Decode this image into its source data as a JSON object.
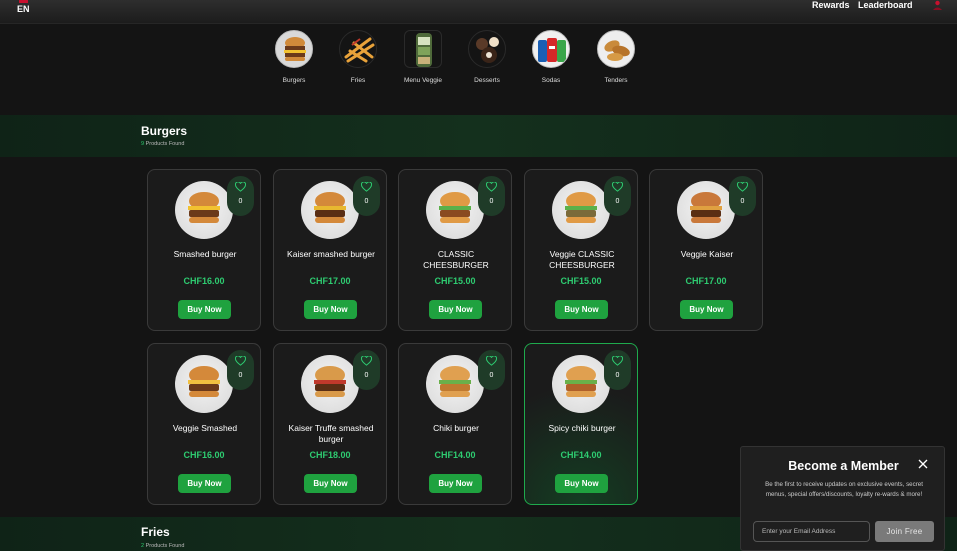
{
  "header": {
    "language": "EN",
    "nav": [
      "Rewards",
      "Leaderboard"
    ]
  },
  "categories": [
    {
      "label": "Burgers",
      "icon": "burger-icon"
    },
    {
      "label": "Fries",
      "icon": "fries-icon"
    },
    {
      "label": "Menu Veggie",
      "icon": "veggie-wrap-icon"
    },
    {
      "label": "Desserts",
      "icon": "dessert-icon"
    },
    {
      "label": "Sodas",
      "icon": "soda-cans-icon"
    },
    {
      "label": "Tenders",
      "icon": "tenders-icon"
    }
  ],
  "sections": [
    {
      "title": "Burgers",
      "count": "9",
      "count_suffix": " Products Found"
    },
    {
      "title": "Fries",
      "count": "2",
      "count_suffix": " Products Found"
    }
  ],
  "products": [
    {
      "name": "Smashed burger",
      "price": "CHF16.00",
      "likes": "0",
      "buy": "Buy Now",
      "image": "smashed-burger-image"
    },
    {
      "name": "Kaiser smashed burger",
      "price": "CHF17.00",
      "likes": "0",
      "buy": "Buy Now",
      "image": "kaiser-burger-image"
    },
    {
      "name": "CLASSIC CHEESBURGER",
      "price": "CHF15.00",
      "likes": "0",
      "buy": "Buy Now",
      "image": "classic-cheeseburger-image"
    },
    {
      "name": "Veggie CLASSIC CHEESBURGER",
      "price": "CHF15.00",
      "likes": "0",
      "buy": "Buy Now",
      "image": "veggie-cheeseburger-image"
    },
    {
      "name": "Veggie Kaiser",
      "price": "CHF17.00",
      "likes": "0",
      "buy": "Buy Now",
      "image": "veggie-kaiser-image"
    },
    {
      "name": "Veggie Smashed",
      "price": "CHF16.00",
      "likes": "0",
      "buy": "Buy Now",
      "image": "veggie-smashed-image"
    },
    {
      "name": "Kaiser Truffe smashed burger",
      "price": "CHF18.00",
      "likes": "0",
      "buy": "Buy Now",
      "image": "kaiser-truffe-image"
    },
    {
      "name": "Chiki burger",
      "price": "CHF14.00",
      "likes": "0",
      "buy": "Buy Now",
      "image": "chiki-burger-image"
    },
    {
      "name": "Spicy chiki burger",
      "price": "CHF14.00",
      "likes": "0",
      "buy": "Buy Now",
      "image": "spicy-chiki-burger-image"
    }
  ],
  "popup": {
    "title": "Become a Member",
    "description": "Be the first to receive updates on exclusive events, secret menus, special offers/discounts, loyalty re-wards & more!",
    "email_placeholder": "Enter your Email Address",
    "join_label": "Join Free"
  },
  "colors": {
    "accent": "#1fa23f",
    "price": "#2ecc71",
    "background": "#141414",
    "band": "#14301d"
  }
}
